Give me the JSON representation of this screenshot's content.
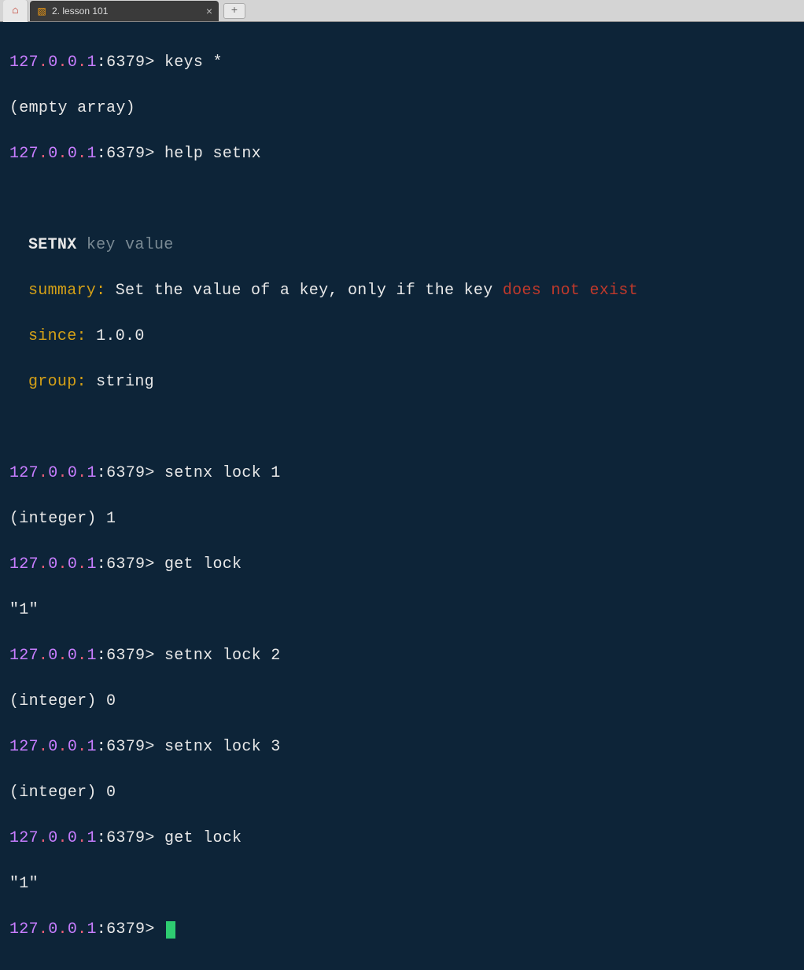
{
  "tab": {
    "title": "2. lesson 101"
  },
  "prompt": {
    "ip_a": "127",
    "ip_b": "0",
    "ip_c": "0",
    "ip_d": "1",
    "port": "6379",
    "gt": ">"
  },
  "lines": {
    "cmd1": "keys *",
    "out1": "(empty array)",
    "cmd2": "help setnx",
    "help_cmd": "SETNX",
    "help_args": "key value",
    "help_summary_label": "summary:",
    "help_summary_text": " Set the value of a key, only if the key ",
    "help_summary_highlight": "does not exist",
    "help_since_label": "since:",
    "help_since_text": " 1.0.0",
    "help_group_label": "group:",
    "help_group_text": " string",
    "cmd3": "setnx lock 1",
    "out3": "(integer) 1",
    "cmd4": "get lock",
    "out4": "\"1\"",
    "cmd5": "setnx lock 2",
    "out5": "(integer) 0",
    "cmd6": "setnx lock 3",
    "out6": "(integer) 0",
    "cmd7": "get lock",
    "out7": "\"1\""
  }
}
